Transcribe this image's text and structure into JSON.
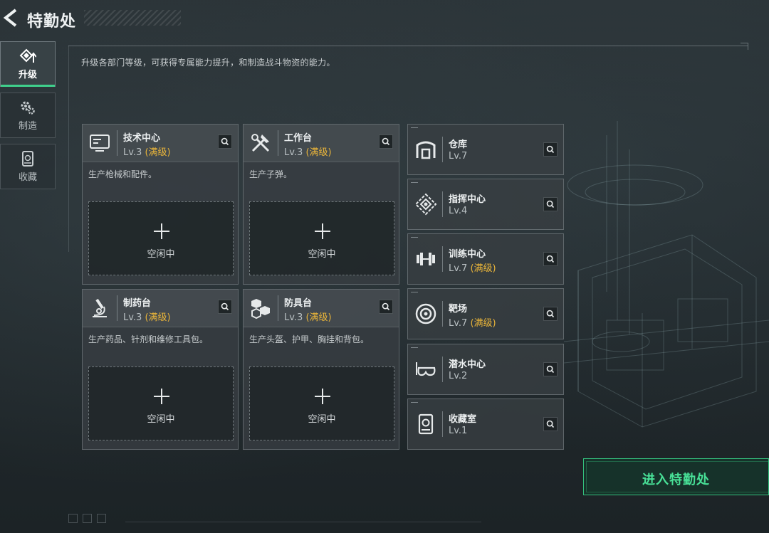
{
  "header": {
    "title": "特勤处",
    "back_icon": "back-chevron-icon"
  },
  "sidebar": {
    "tabs": [
      {
        "label": "升级",
        "icon": "upgrade-icon",
        "active": true
      },
      {
        "label": "制造",
        "icon": "gears-icon",
        "active": false
      },
      {
        "label": "收藏",
        "icon": "collection-icon",
        "active": false
      }
    ]
  },
  "description": "升级各部门等级，可获得专属能力提升，和制造战斗物资的能力。",
  "workshops": [
    {
      "name": "技术中心",
      "level": "Lv.3",
      "max_tag": "(满级)",
      "desc": "生产枪械和配件。",
      "slot_label": "空闲中",
      "icon": "tech-center-icon"
    },
    {
      "name": "工作台",
      "level": "Lv.3",
      "max_tag": "(满级)",
      "desc": "生产子弹。",
      "slot_label": "空闲中",
      "icon": "workbench-tools-icon"
    },
    {
      "name": "制药台",
      "level": "Lv.3",
      "max_tag": "(满级)",
      "desc": "生产药品、针剂和维修工具包。",
      "slot_label": "空闲中",
      "icon": "microscope-icon"
    },
    {
      "name": "防具台",
      "level": "Lv.3",
      "max_tag": "(满级)",
      "desc": "生产头盔、护甲、胸挂和背包。",
      "slot_label": "空闲中",
      "icon": "armor-cubes-icon"
    }
  ],
  "facilities": [
    {
      "name": "仓库",
      "level": "Lv.7",
      "max_tag": "",
      "icon": "warehouse-icon"
    },
    {
      "name": "指挥中心",
      "level": "Lv.4",
      "max_tag": "",
      "icon": "command-center-icon"
    },
    {
      "name": "训练中心",
      "level": "Lv.7",
      "max_tag": "(满级)",
      "icon": "dumbbell-icon"
    },
    {
      "name": "靶场",
      "level": "Lv.7",
      "max_tag": "(满级)",
      "icon": "target-icon"
    },
    {
      "name": "潜水中心",
      "level": "Lv.2",
      "max_tag": "",
      "icon": "diving-mask-icon"
    },
    {
      "name": "收藏室",
      "level": "Lv.1",
      "max_tag": "",
      "icon": "collection-room-icon"
    }
  ],
  "enter_button": {
    "label": "进入特勤处"
  },
  "colors": {
    "accent_green": "#34c27f",
    "max_level_gold": "#e8b43a",
    "panel": "#383e42"
  }
}
